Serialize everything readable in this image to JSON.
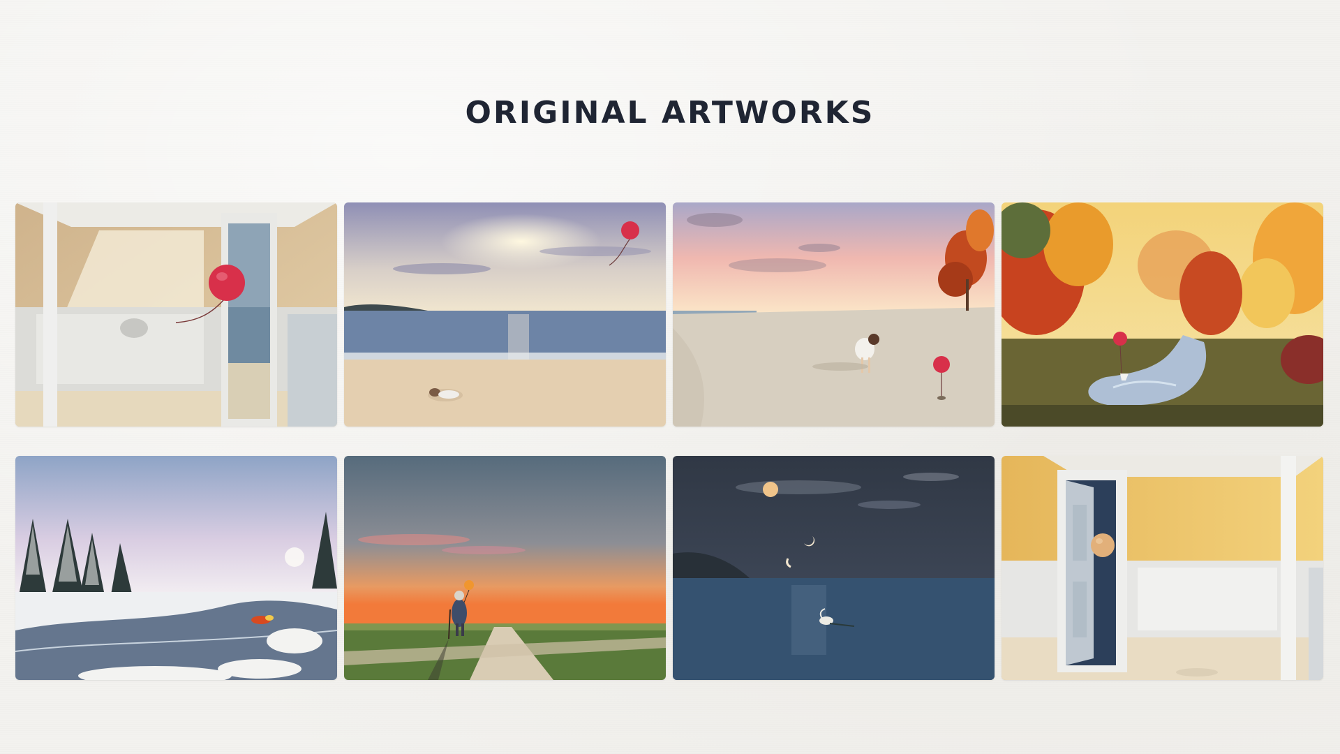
{
  "page": {
    "title": "ORIGINAL ARTWORKS"
  },
  "gallery": {
    "items": [
      {
        "subject": "interior-room-with-red-balloon"
      },
      {
        "subject": "beach-sunset-with-sleeping-child-and-balloon"
      },
      {
        "subject": "pink-sky-beach-girl-with-red-balloon"
      },
      {
        "subject": "autumn-forest-stream-with-paper-boat"
      },
      {
        "subject": "snowy-river-with-deflated-balloon"
      },
      {
        "subject": "orange-sunset-path-with-elderly-figure-and-balloon"
      },
      {
        "subject": "night-sea-with-moon-and-swan"
      },
      {
        "subject": "yellow-room-with-open-door-and-balloon"
      }
    ]
  },
  "colors": {
    "background": "#f3f2ef",
    "title": "#1f2533",
    "balloon_red": "#d8304a"
  }
}
